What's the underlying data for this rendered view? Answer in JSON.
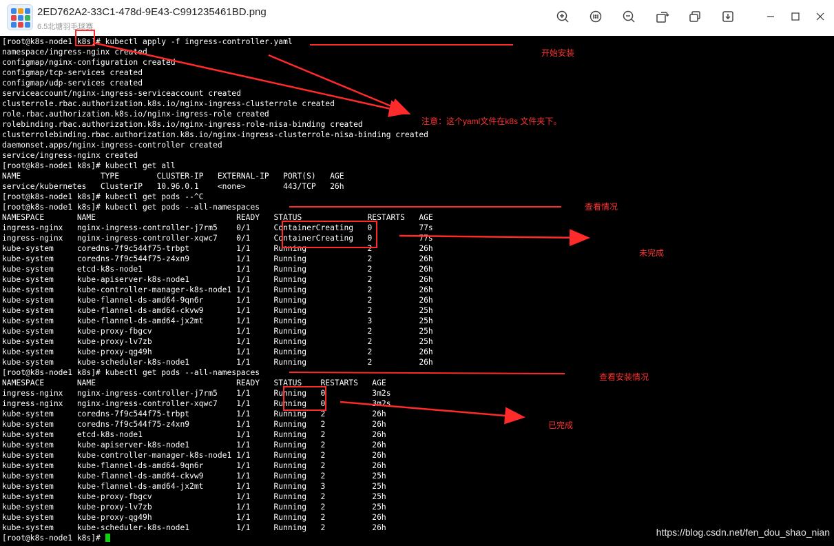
{
  "window": {
    "title": "2ED762A2-33C1-478d-9E43-C991235461BD.png",
    "subtitle": "6.5北塘羽毛球赛",
    "toolbar_icons": [
      "zoom-in-icon",
      "actual-size-icon",
      "zoom-out-icon",
      "rotate-icon",
      "copy-icon",
      "download-icon"
    ],
    "window_controls": [
      "minimize-icon",
      "maximize-icon",
      "close-icon"
    ]
  },
  "terminal": {
    "lines": [
      "[root@k8s-node1 k8s]# kubectl apply -f ingress-controller.yaml",
      "namespace/ingress-nginx created",
      "configmap/nginx-configuration created",
      "configmap/tcp-services created",
      "configmap/udp-services created",
      "serviceaccount/nginx-ingress-serviceaccount created",
      "clusterrole.rbac.authorization.k8s.io/nginx-ingress-clusterrole created",
      "role.rbac.authorization.k8s.io/nginx-ingress-role created",
      "rolebinding.rbac.authorization.k8s.io/nginx-ingress-role-nisa-binding created",
      "clusterrolebinding.rbac.authorization.k8s.io/nginx-ingress-clusterrole-nisa-binding created",
      "daemonset.apps/nginx-ingress-controller created",
      "service/ingress-nginx created",
      "[root@k8s-node1 k8s]# kubectl get all",
      "NAME                 TYPE        CLUSTER-IP   EXTERNAL-IP   PORT(S)   AGE",
      "service/kubernetes   ClusterIP   10.96.0.1    <none>        443/TCP   26h",
      "[root@k8s-node1 k8s]# kubectl get pods --^C",
      "[root@k8s-node1 k8s]# kubectl get pods --all-namespaces",
      "NAMESPACE       NAME                              READY   STATUS              RESTARTS   AGE",
      "ingress-nginx   nginx-ingress-controller-j7rm5    0/1     ContainerCreating   0          77s",
      "ingress-nginx   nginx-ingress-controller-xqwc7    0/1     ContainerCreating   0          77s",
      "kube-system     coredns-7f9c544f75-trbpt          1/1     Running             2          26h",
      "kube-system     coredns-7f9c544f75-z4xn9          1/1     Running             2          26h",
      "kube-system     etcd-k8s-node1                    1/1     Running             2          26h",
      "kube-system     kube-apiserver-k8s-node1          1/1     Running             2          26h",
      "kube-system     kube-controller-manager-k8s-node1 1/1     Running             2          26h",
      "kube-system     kube-flannel-ds-amd64-9qn6r       1/1     Running             2          26h",
      "kube-system     kube-flannel-ds-amd64-ckvw9       1/1     Running             2          25h",
      "kube-system     kube-flannel-ds-amd64-jx2mt       1/1     Running             3          25h",
      "kube-system     kube-proxy-fbgcv                  1/1     Running             2          25h",
      "kube-system     kube-proxy-lv7zb                  1/1     Running             2          25h",
      "kube-system     kube-proxy-qg49h                  1/1     Running             2          26h",
      "kube-system     kube-scheduler-k8s-node1          1/1     Running             2          26h",
      "[root@k8s-node1 k8s]# kubectl get pods --all-namespaces",
      "NAMESPACE       NAME                              READY   STATUS    RESTARTS   AGE",
      "ingress-nginx   nginx-ingress-controller-j7rm5    1/1     Running   0          3m2s",
      "ingress-nginx   nginx-ingress-controller-xqwc7    1/1     Running   0          3m2s",
      "kube-system     coredns-7f9c544f75-trbpt          1/1     Running   2          26h",
      "kube-system     coredns-7f9c544f75-z4xn9          1/1     Running   2          26h",
      "kube-system     etcd-k8s-node1                    1/1     Running   2          26h",
      "kube-system     kube-apiserver-k8s-node1          1/1     Running   2          26h",
      "kube-system     kube-controller-manager-k8s-node1 1/1     Running   2          26h",
      "kube-system     kube-flannel-ds-amd64-9qn6r       1/1     Running   2          26h",
      "kube-system     kube-flannel-ds-amd64-ckvw9       1/1     Running   2          25h",
      "kube-system     kube-flannel-ds-amd64-jx2mt       1/1     Running   3          25h",
      "kube-system     kube-proxy-fbgcv                  1/1     Running   2          25h",
      "kube-system     kube-proxy-lv7zb                  1/1     Running   2          25h",
      "kube-system     kube-proxy-qg49h                  1/1     Running   2          26h",
      "kube-system     kube-scheduler-k8s-node1          1/1     Running   2          26h",
      "[root@k8s-node1 k8s]# "
    ],
    "text_color": "#ffffff",
    "background": "#000000",
    "cursor_color": "#10d010"
  },
  "annotations": {
    "start_install": "开始安装",
    "note_yaml": "注意：这个yaml文件在k8s 文件夹下。",
    "view_status": "查看情况",
    "not_complete": "未完成",
    "view_install_status": "查看安装情况",
    "complete": "已完成",
    "color": "#ff3333"
  },
  "watermark": "https://blog.csdn.net/fen_dou_shao_nian"
}
